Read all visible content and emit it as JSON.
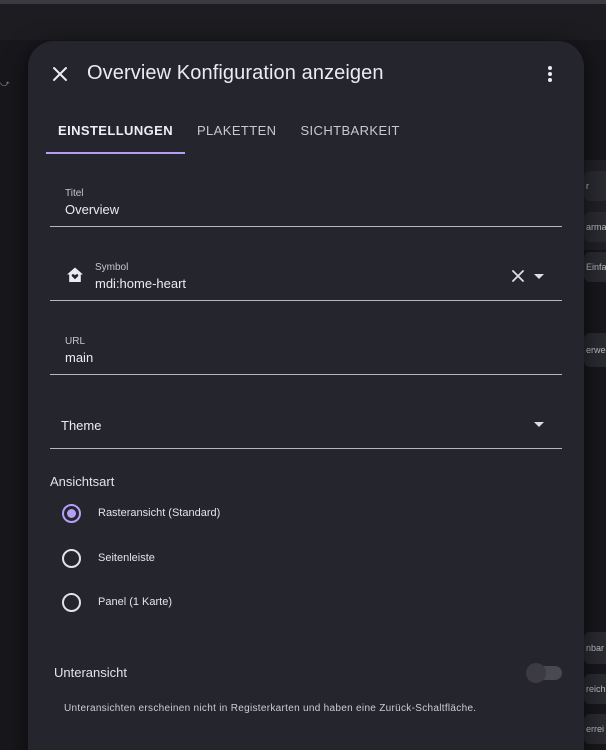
{
  "dialog": {
    "title": "Overview Konfiguration anzeigen"
  },
  "tabs": [
    {
      "label": "EINSTELLUNGEN",
      "active": true
    },
    {
      "label": "PLAKETTEN",
      "active": false
    },
    {
      "label": "SICHTBARKEIT",
      "active": false
    }
  ],
  "fields": {
    "title": {
      "label": "Titel",
      "value": "Overview"
    },
    "icon": {
      "label": "Symbol",
      "value": "mdi:home-heart"
    },
    "url": {
      "label": "URL",
      "value": "main"
    },
    "theme": {
      "placeholder": "Theme"
    }
  },
  "view_type": {
    "heading": "Ansichtsart",
    "options": [
      {
        "label": "Rasteransicht (Standard)",
        "checked": true
      },
      {
        "label": "Seitenleiste",
        "checked": false
      },
      {
        "label": "Panel (1 Karte)",
        "checked": false
      }
    ]
  },
  "subview": {
    "label": "Unteransicht",
    "enabled": false,
    "description": "Unteransichten erscheinen nicht in Registerkarten und haben eine Zurück-Schaltfläche."
  },
  "background": {
    "glyph": "⤻",
    "snippets": [
      "r",
      "arman",
      "Einfal",
      "erwed",
      "nbar",
      "reich",
      "errei"
    ]
  },
  "colors": {
    "accent": "#b69df8",
    "surface": "#25252e",
    "background": "#17171c"
  }
}
